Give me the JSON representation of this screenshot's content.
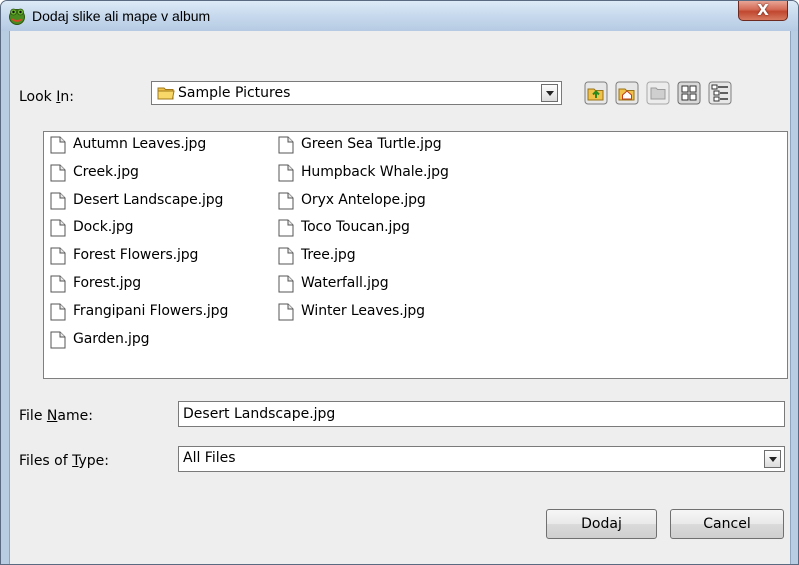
{
  "window": {
    "title": "Dodaj slike ali mape v album",
    "close_glyph": "X"
  },
  "look_in": {
    "label_pre": "Look ",
    "label_mnemonic": "I",
    "label_post": "n:",
    "value": "Sample Pictures"
  },
  "toolbar": {
    "icons": [
      "up-folder-icon",
      "home-icon",
      "new-folder-icon",
      "list-view-icon",
      "details-view-icon"
    ]
  },
  "files": {
    "column1": [
      "Autumn Leaves.jpg",
      "Creek.jpg",
      "Desert Landscape.jpg",
      "Dock.jpg",
      "Forest Flowers.jpg",
      "Forest.jpg",
      "Frangipani Flowers.jpg",
      "Garden.jpg"
    ],
    "column2": [
      "Green Sea Turtle.jpg",
      "Humpback Whale.jpg",
      "Oryx Antelope.jpg",
      "Toco Toucan.jpg",
      "Tree.jpg",
      "Waterfall.jpg",
      "Winter Leaves.jpg"
    ]
  },
  "file_name": {
    "label_pre": "File ",
    "label_mnemonic": "N",
    "label_post": "ame:",
    "value": "Desert Landscape.jpg"
  },
  "file_type": {
    "label_pre": "Files of ",
    "label_mnemonic": "T",
    "label_post": "ype:",
    "value": "All Files"
  },
  "buttons": {
    "add": "Dodaj",
    "cancel": "Cancel"
  }
}
